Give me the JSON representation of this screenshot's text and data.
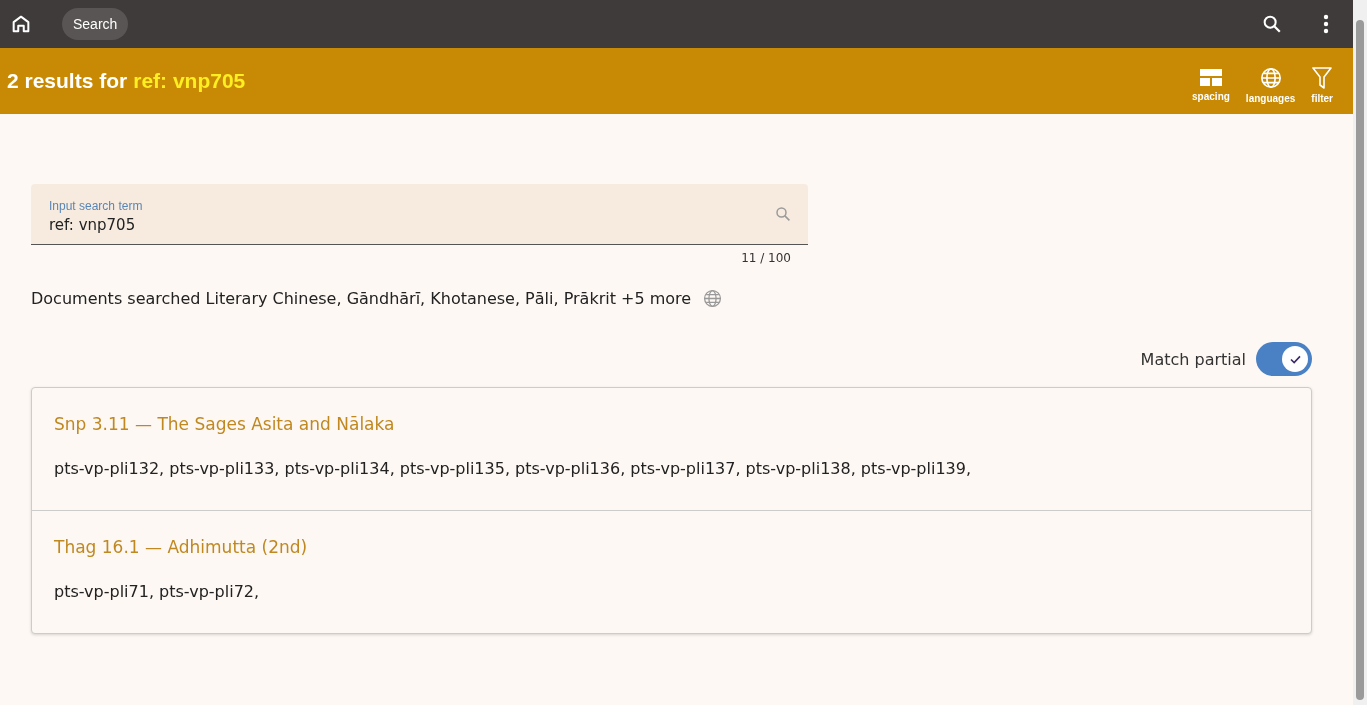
{
  "top_bar": {
    "search_chip": "Search"
  },
  "header": {
    "title": "2 results for",
    "query": "ref: vnp705",
    "actions": [
      {
        "kind": "spacing",
        "label": "spacing"
      },
      {
        "kind": "languages",
        "label": "languages"
      },
      {
        "kind": "filter",
        "label": "filter"
      }
    ]
  },
  "search": {
    "label": "Input search term",
    "value": "ref: vnp705",
    "counter": "11 / 100"
  },
  "documents_searched": "Documents searched Literary Chinese, Gāndhārī, Khotanese, Pāli, Prākrit +5 more",
  "match_partial": {
    "label": "Match partial",
    "on": true
  },
  "results": [
    {
      "title": "Snp 3.11 — The Sages Asita and Nālaka",
      "refs": "pts-vp-pli132, pts-vp-pli133, pts-vp-pli134, pts-vp-pli135, pts-vp-pli136, pts-vp-pli137, pts-vp-pli138, pts-vp-pli139,"
    },
    {
      "title": "Thag 16.1 — Adhimutta (2nd)",
      "refs": "pts-vp-pli71, pts-vp-pli72,"
    }
  ]
}
